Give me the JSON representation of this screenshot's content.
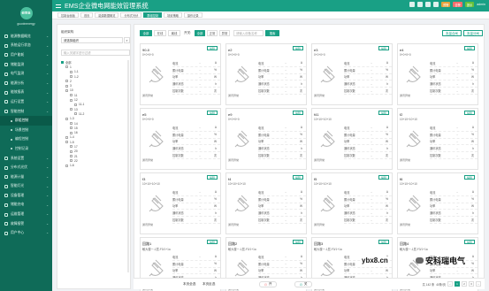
{
  "app": {
    "title": "EMS企业微电网能效管理系统",
    "user": "guoxinenergy",
    "logo": "ems"
  },
  "sidebar": {
    "items": [
      "能源数据概览",
      "系统运行状态",
      "用户能耗",
      "储能监测",
      "电气监测",
      "能源分析",
      "能效报表",
      "运行设置",
      "智能控制"
    ],
    "sub": [
      "群组控制",
      "场景控制",
      "编程控制",
      "控制记录"
    ],
    "items2": [
      "系统设置",
      "分布式光伏",
      "能源计量",
      "智能灯光",
      "设备管理",
      "储能充电",
      "运维管理",
      "故障报警",
      "用户中心"
    ]
  },
  "topbar": {
    "badges": [
      "预警",
      "告警",
      "提示"
    ],
    "account": "admin"
  },
  "tabs": [
    "控制台面板",
    "首页",
    "能源数据概览",
    "分布式光伏",
    "群组控制",
    "场景策略",
    "操作记录"
  ],
  "tree": {
    "label": "组织架构",
    "select": "请选择组织",
    "search_placeholder": "输入关键字进行过滤",
    "nodes": [
      "全部",
      "1",
      "1-1",
      "1-2",
      "2",
      "3",
      "10",
      "11",
      "12",
      "11-1",
      "13",
      "11-2",
      "1-3",
      "14",
      "15",
      "16",
      "1-4",
      "1-5",
      "17",
      "20",
      "21",
      "22",
      "1-6"
    ]
  },
  "toolbar": {
    "all": "全部",
    "online": "在线",
    "offline": "离线",
    "switch_label": "开关:",
    "sw_all": "全部",
    "sw_on": "正常",
    "sw_off": "异常",
    "search_placeholder": "请输入设备名称",
    "search": "搜索",
    "batch_on": "批量合闸",
    "batch_off": "批量分闸"
  },
  "card_labels": {
    "edit": "编辑",
    "current": "电流",
    "energy": "累计电量",
    "power": "功率",
    "status": "通讯状态",
    "control": "控制次数",
    "note": "通讯异常"
  },
  "units": {
    "current": "A",
    "energy": "%",
    "power": "W",
    "status": "h",
    "control": "次"
  },
  "cards": [
    {
      "name": "90-0",
      "addr": "0+0+0+0"
    },
    {
      "name": "e2",
      "addr": "0+0+0+0"
    },
    {
      "name": "e3",
      "addr": "0+0+0+0"
    },
    {
      "name": "e4",
      "addr": "0+0+0+0"
    },
    {
      "name": "e5",
      "addr": "0+0+0+0"
    },
    {
      "name": "e9",
      "addr": "0+0+0+0"
    },
    {
      "name": "f41",
      "addr": "10+10+10+10"
    },
    {
      "name": "f2",
      "addr": "10+10+10+10"
    },
    {
      "name": "f3",
      "addr": "10+10+10+10"
    },
    {
      "name": "f4",
      "addr": "10+10+10+10"
    },
    {
      "name": "f5",
      "addr": "10+10+10+10"
    },
    {
      "name": "f6",
      "addr": "10+10+10+10"
    },
    {
      "name": "回路1",
      "addr": "敏大楼一-1层-F3/1+1a"
    },
    {
      "name": "回路2",
      "addr": "敏大楼一-1层-F3/1+1a"
    },
    {
      "name": "回路3",
      "addr": "敏大楼一-1层-F3/1+1a"
    },
    {
      "name": "回路4",
      "addr": "敏大楼一-1层-F3/1+1a"
    }
  ],
  "bottom": {
    "sel_all": "本页全选",
    "inv": "本页反选",
    "open": "开",
    "close": "关",
    "total": "共 142 条",
    "per": "40条/页",
    "pages": [
      "1",
      "2",
      "3"
    ]
  },
  "watermark": {
    "site": "ybx8.cn",
    "brand": "安科瑞电气"
  }
}
